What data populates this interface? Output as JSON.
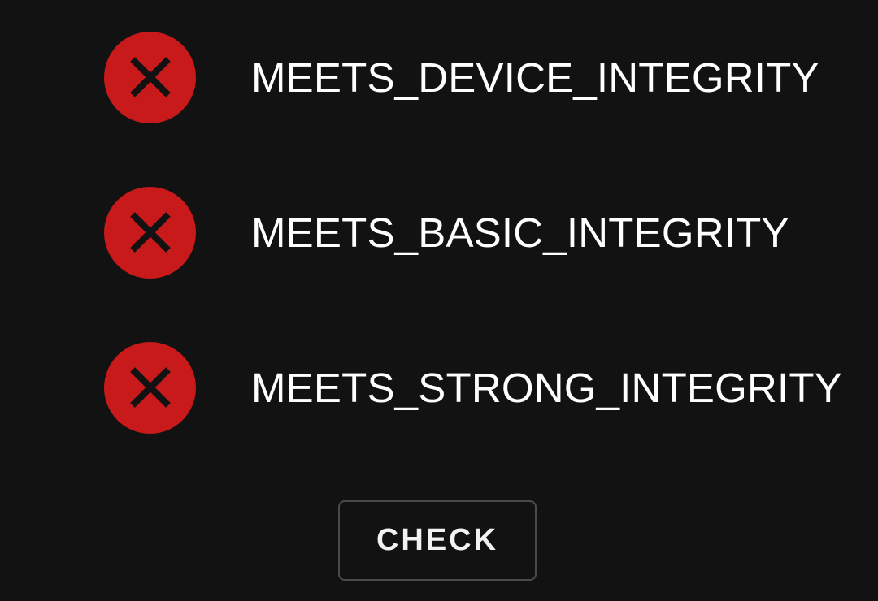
{
  "checks": [
    {
      "label": "MEETS_DEVICE_INTEGRITY",
      "status": "fail",
      "icon": "x-circle-icon"
    },
    {
      "label": "MEETS_BASIC_INTEGRITY",
      "status": "fail",
      "icon": "x-circle-icon"
    },
    {
      "label": "MEETS_STRONG_INTEGRITY",
      "status": "fail",
      "icon": "x-circle-icon"
    }
  ],
  "check_button": {
    "label": "CHECK"
  },
  "colors": {
    "background": "#121212",
    "fail_red": "#c8191b",
    "text": "#ffffff",
    "button_border": "#4a4a4a"
  }
}
